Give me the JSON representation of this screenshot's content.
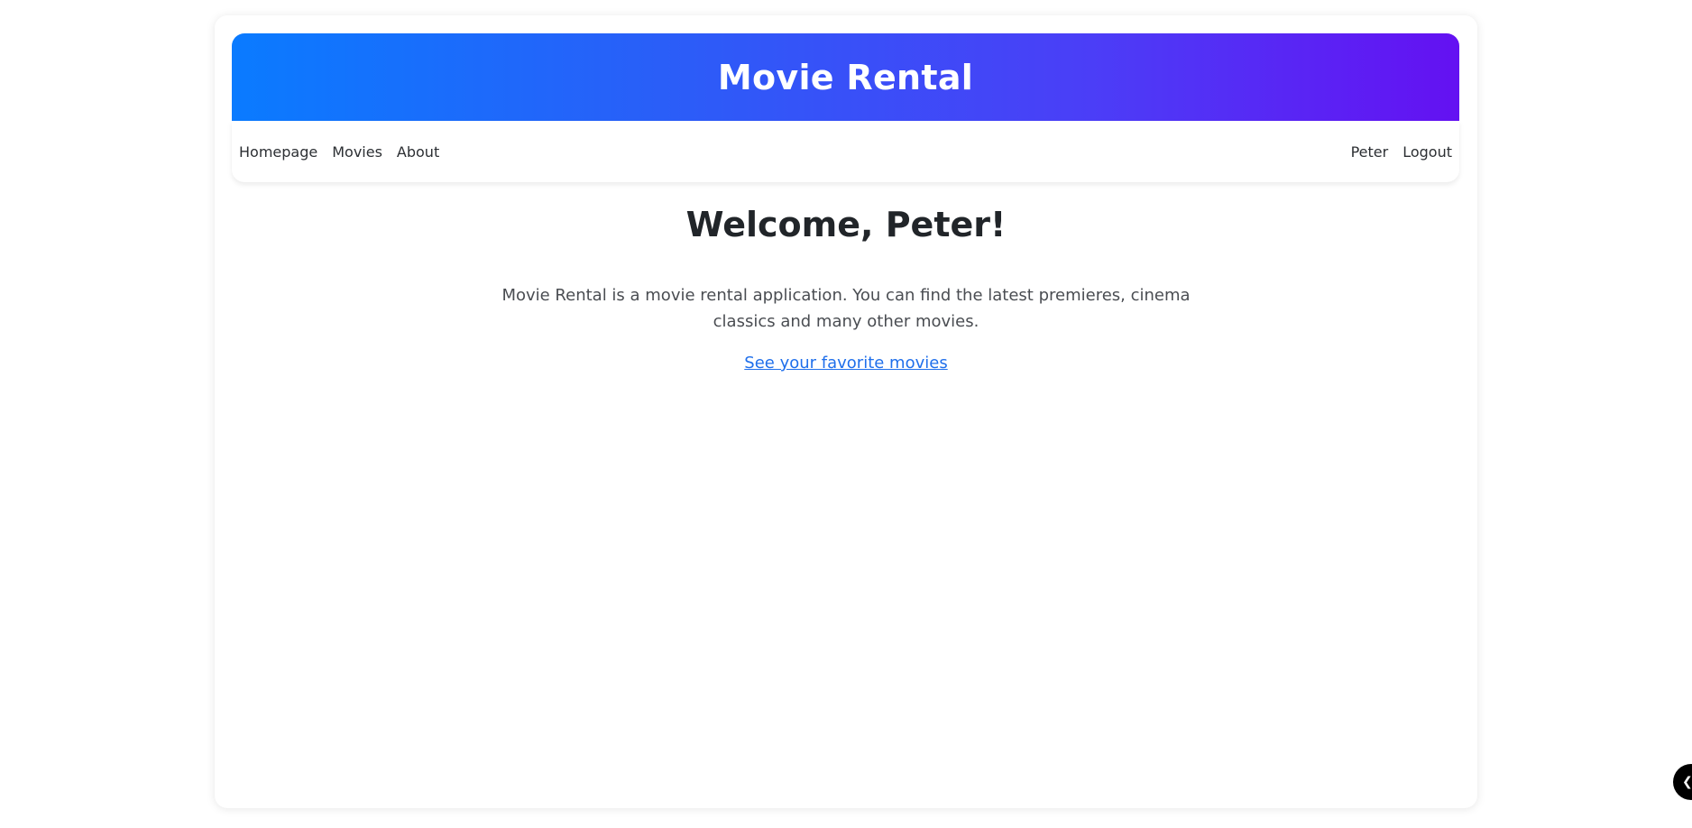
{
  "app": {
    "title": "Movie Rental"
  },
  "nav": {
    "left": [
      "Homepage",
      "Movies",
      "About"
    ],
    "right": [
      "Peter",
      "Logout"
    ]
  },
  "main": {
    "welcome": "Welcome, Peter!",
    "intro": "Movie Rental is a movie rental application. You can find the latest premieres, cinema classics and many other movies.",
    "favorites_link": "See your favorite movies"
  },
  "floating_button": {
    "icon": "chevron-left-icon",
    "glyph": "❮"
  },
  "colors": {
    "header_gradient_start": "#0a7bff",
    "header_gradient_end": "#6411f2",
    "link": "#1f6feb"
  }
}
